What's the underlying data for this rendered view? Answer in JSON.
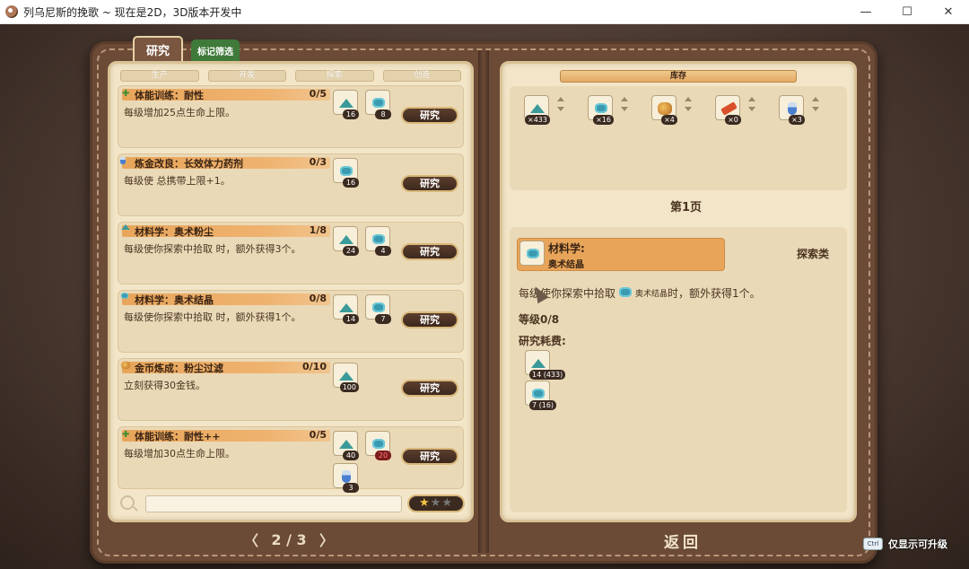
{
  "window": {
    "title": "列乌尼斯的挽歌 ~ 现在是2D，3D版本开发中",
    "minimize": "—",
    "maximize": "☐",
    "close": "✕"
  },
  "tabs": {
    "research": "研究",
    "mark_filter": "标记筛选"
  },
  "categories": [
    "生产",
    "开发",
    "探索",
    "创造"
  ],
  "research_items": [
    {
      "icon": "heal-plus-icon",
      "icon_glyph": "✚",
      "title": "体能训练：耐性",
      "progress": "0/5",
      "desc": "每级增加25点生命上限。",
      "button": "研究",
      "costs": [
        {
          "item": "arcane-dust",
          "qty": "16"
        },
        {
          "item": "arcane-crystal",
          "qty": "8"
        }
      ]
    },
    {
      "icon": "potion-icon",
      "title": "炼金改良：长效体力药剂",
      "progress": "0/3",
      "desc": "每级使 总携带上限+1。",
      "button": "研究",
      "costs": [
        {
          "item": "arcane-crystal",
          "qty": "16"
        }
      ]
    },
    {
      "icon": "dust-icon",
      "title": "材料学：奥术粉尘",
      "progress": "1/8",
      "desc": "每级使你探索中拾取 时，额外获得3个。",
      "button": "研究",
      "costs": [
        {
          "item": "arcane-dust",
          "qty": "24"
        },
        {
          "item": "arcane-crystal",
          "qty": "4"
        }
      ]
    },
    {
      "icon": "crystal-icon",
      "title": "材料学：奥术结晶",
      "progress": "0/8",
      "desc": "每级使你探索中拾取 时，额外获得1个。",
      "button": "研究",
      "costs": [
        {
          "item": "arcane-dust",
          "qty": "14"
        },
        {
          "item": "arcane-crystal",
          "qty": "7"
        }
      ]
    },
    {
      "icon": "gold-icon",
      "title": "金币炼成：粉尘过滤",
      "progress": "0/10",
      "desc": "立刻获得30金钱。",
      "button": "研究",
      "costs": [
        {
          "item": "arcane-dust",
          "qty": "100"
        }
      ]
    },
    {
      "icon": "heal-plus-icon",
      "icon_glyph": "✚",
      "title": "体能训练：耐性++",
      "progress": "0/5",
      "desc": "每级增加30点生命上限。",
      "button": "研究",
      "costs": [
        {
          "item": "arcane-dust",
          "qty": "40"
        },
        {
          "item": "arcane-crystal",
          "qty": "20",
          "insufficient": true
        },
        {
          "item": "potion",
          "qty": "3"
        }
      ]
    }
  ],
  "stars": {
    "filled": "★",
    "empty": "★★"
  },
  "pager": {
    "prev": "〈",
    "label": "2 / 3",
    "next": "〉"
  },
  "inventory": {
    "header": "库存",
    "items": [
      {
        "item": "arcane-dust",
        "qty": "×433"
      },
      {
        "item": "arcane-crystal",
        "qty": "×16"
      },
      {
        "item": "ore",
        "qty": "×4"
      },
      {
        "item": "red-bar",
        "qty": "×0"
      },
      {
        "item": "potion",
        "qty": "×3"
      }
    ],
    "page_label": "第1页"
  },
  "detail": {
    "title": "材料学:",
    "subtitle": "奥术结晶",
    "category": "探索类",
    "desc_prefix": "每级使你探索中拾取",
    "desc_item": "奥术结晶",
    "desc_suffix": "时，额外获得1个。",
    "level": "等级0/8",
    "cost_label": "研究耗费:",
    "costs": [
      {
        "item": "arcane-dust",
        "qty": "14 (433)"
      },
      {
        "item": "arcane-crystal",
        "qty": "7 (16)"
      }
    ]
  },
  "back_button": "返回",
  "hint": {
    "key": "Ctrl",
    "text": "仅显示可升级"
  }
}
